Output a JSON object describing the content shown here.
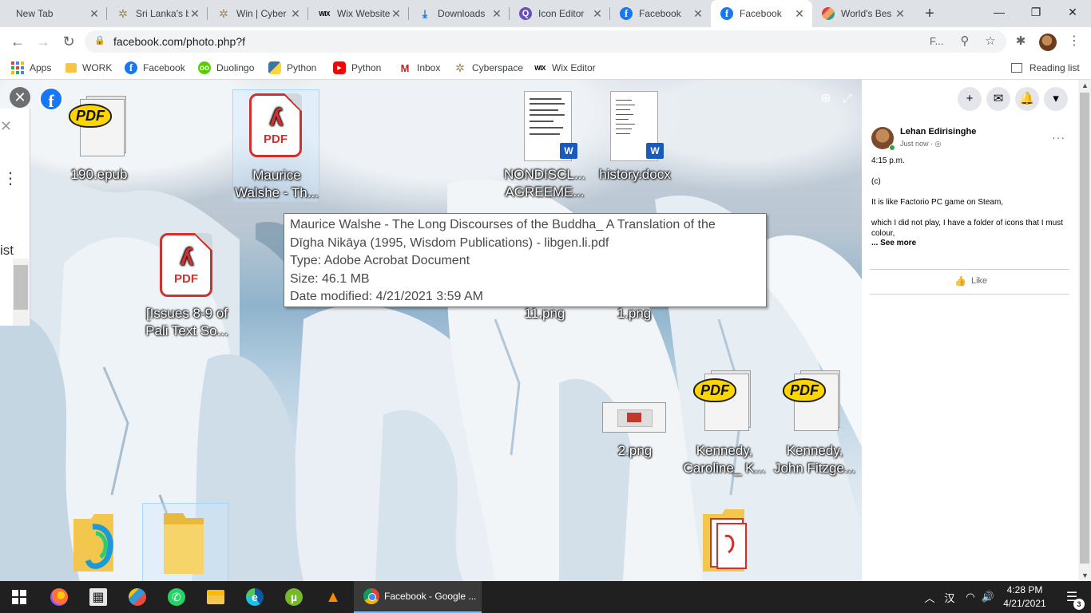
{
  "tabs": [
    {
      "title": "New Tab",
      "icon": "none"
    },
    {
      "title": "Sri Lanka's b",
      "icon": "star-icon"
    },
    {
      "title": "Win | Cyber",
      "icon": "star-icon"
    },
    {
      "title": "Wix Website",
      "icon": "wix-icon",
      "icon_text": "WIX"
    },
    {
      "title": "Downloads",
      "icon": "download-icon"
    },
    {
      "title": "Icon Editor",
      "icon": "icon-editor-icon",
      "icon_text": "Q"
    },
    {
      "title": "Facebook",
      "icon": "facebook-icon",
      "icon_text": "f"
    },
    {
      "title": "Facebook",
      "icon": "facebook-icon",
      "icon_text": "f",
      "active": true
    },
    {
      "title": "World's Bes",
      "icon": "worlds-best-icon"
    }
  ],
  "window": {
    "new_tab": "+",
    "minimize": "—",
    "maximize": "❐",
    "close": "✕"
  },
  "toolbar": {
    "back": "←",
    "forward": "→",
    "reload": "↻",
    "url": "facebook.com/photo.php?f",
    "truncated_text": "F...",
    "zoom_glyph": "⚲",
    "star_glyph": "☆",
    "ext_glyph": "✱",
    "menu_glyph": "⋮"
  },
  "bookmarks": [
    {
      "label": "Apps",
      "icon": "apps-icon"
    },
    {
      "label": "WORK",
      "icon": "folder-icon"
    },
    {
      "label": "Facebook",
      "icon": "facebook-icon",
      "icon_text": "f"
    },
    {
      "label": "Duolingo",
      "icon": "duolingo-icon",
      "icon_text": "oo"
    },
    {
      "label": "Python",
      "icon": "python-icon"
    },
    {
      "label": "Python",
      "icon": "youtube-icon",
      "icon_text": "▶"
    },
    {
      "label": "Inbox",
      "icon": "gmail-icon",
      "icon_text": "M"
    },
    {
      "label": "Cyberspace",
      "icon": "star-icon"
    },
    {
      "label": "Wix Editor",
      "icon": "wix-icon",
      "icon_text": "WIX"
    }
  ],
  "reading_list": "Reading list",
  "photo": {
    "close_glyph": "✕",
    "fb_glyph": "f",
    "zoom_out_glyph": "⊖",
    "zoom_in_glyph": "⊕",
    "fullscreen_glyph": "⤢",
    "left_peek": {
      "close": "✕",
      "dots": "⋮",
      "text": "ist",
      "up": "▲"
    },
    "desktop_icons": [
      {
        "id": "epub",
        "label1": "190.epub",
        "label2": "",
        "type": "sumatra-pdf"
      },
      {
        "id": "maurice",
        "label1": "Maurice",
        "label2": "Walshe - Th...",
        "type": "acrobat-pdf"
      },
      {
        "id": "nondisc",
        "label1": "NONDISCL...",
        "label2": "AGREEME...",
        "type": "word-doc"
      },
      {
        "id": "history",
        "label1": "history.docx",
        "label2": "",
        "type": "word-doc"
      },
      {
        "id": "issues",
        "label1": "[Issues 8-9 of",
        "label2": "Pali Text So...",
        "type": "acrobat-pdf"
      },
      {
        "id": "p11",
        "label1": "11.png",
        "label2": "",
        "type": "png"
      },
      {
        "id": "p1",
        "label1": "1.png",
        "label2": "",
        "type": "png"
      },
      {
        "id": "p2",
        "label1": "2.png",
        "label2": "",
        "type": "png"
      },
      {
        "id": "kennedyc",
        "label1": "Kennedy,",
        "label2": "Caroline_ K...",
        "type": "sumatra-pdf"
      },
      {
        "id": "kennedyj",
        "label1": "Kennedy,",
        "label2": "John Fitzge...",
        "type": "sumatra-pdf"
      }
    ],
    "pdf_text": "PDF",
    "pdf_swirl": "ʎ",
    "word_badge": "W",
    "tooltip": {
      "line1": "Maurice Walshe - The Long Discourses of the Buddha_ A Translation of the",
      "line2": "Dīgha Nikāya (1995, Wisdom Publications) - libgen.li.pdf",
      "line3": "Type: Adobe Acrobat Document",
      "line4": "Size: 46.1 MB",
      "line5": "Date modified: 4/21/2021 3:59 AM"
    }
  },
  "fb": {
    "top_buttons": [
      "+",
      "✉",
      "🔔",
      "▾"
    ],
    "post": {
      "author": "Lehan Edirisinghe",
      "time": "Just now · ◎",
      "more": "···",
      "lines": [
        "4:15 p.m.",
        "(c)",
        "It is like Factorio PC game on Steam,",
        "which I did not play, I have a folder of icons that I must colour,"
      ],
      "see_more": "... See more",
      "like": "Like",
      "like_glyph": "👍"
    }
  },
  "scroll": {
    "up": "▲",
    "down": "▼"
  },
  "taskbar": {
    "chrome_label": "Facebook - Google ...",
    "clock_time": "4:28 PM",
    "clock_date": "4/21/2021",
    "tray_chevron": "︿",
    "tray_ime": "汉",
    "tray_wifi": "◠",
    "tray_volume": "🔊",
    "notif_glyph": "☰",
    "notif_count": "3",
    "calc_glyph": "▦",
    "utorrent_glyph": "µ",
    "vlc_glyph": "▲",
    "edge_glyph": "e",
    "whatsapp_glyph": "✆"
  },
  "colors": {
    "facebook_blue": "#1877f2",
    "acrobat_red": "#d0312d",
    "sumatra_yellow": "#ffd600",
    "taskbar": "#202020"
  }
}
